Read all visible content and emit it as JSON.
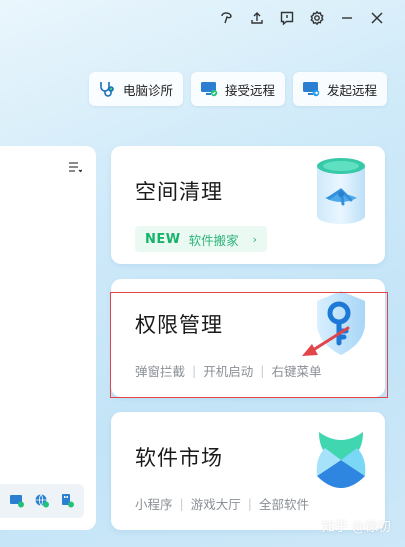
{
  "toolbar": {
    "items": [
      {
        "label": "电脑诊所",
        "icon": "stethoscope-icon"
      },
      {
        "label": "接受远程",
        "icon": "monitor-receive-icon"
      },
      {
        "label": "发起远程",
        "icon": "monitor-send-icon"
      }
    ]
  },
  "titlebar": {
    "icons": [
      "skin-icon",
      "upload-icon",
      "feedback-icon",
      "settings-icon",
      "minimize-icon",
      "close-icon"
    ]
  },
  "cards": {
    "cleanup": {
      "title": "空间清理",
      "badge_new": "NEW",
      "badge_text": "软件搬家",
      "badge_arrow": "›"
    },
    "permissions": {
      "title": "权限管理",
      "links": [
        "弹窗拦截",
        "开机启动",
        "右键菜单"
      ]
    },
    "market": {
      "title": "软件市场",
      "links": [
        "小程序",
        "游戏大厅",
        "全部软件"
      ]
    }
  },
  "separator": "|",
  "watermark": "知乎 @徐初",
  "colors": {
    "accent_green": "#16b36a",
    "highlight_red": "#e0454a",
    "brand_blue": "#1a8fe3"
  }
}
